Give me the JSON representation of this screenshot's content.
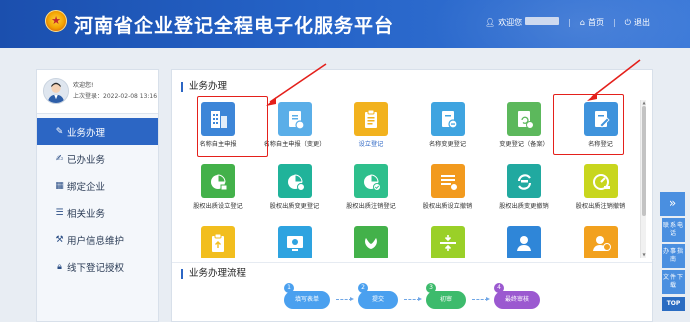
{
  "header": {
    "site_title": "河南省企业登记全程电子化服务平台",
    "welcome_prefix": "欢迎您",
    "home_label": "首页",
    "logout_label": "退出"
  },
  "sidebar": {
    "welcome": "欢迎您!",
    "last_login": "上次登录：2022-02-08 13:16",
    "items": [
      {
        "label": "业务办理",
        "icon": "pen-icon",
        "active": true
      },
      {
        "label": "已办业务",
        "icon": "doc-edit-icon"
      },
      {
        "label": "绑定企业",
        "icon": "building-icon"
      },
      {
        "label": "相关业务",
        "icon": "doc-icon"
      },
      {
        "label": "用户信息维护",
        "icon": "tools-icon"
      },
      {
        "label": "线下登记授权",
        "icon": "lock-icon"
      }
    ]
  },
  "main": {
    "section_business": "业务办理",
    "section_flow": "业务办理流程",
    "tiles": [
      {
        "label": "名称自主申报",
        "color": "#3d86d8",
        "icon": "building-grid-icon",
        "accent": false
      },
      {
        "label": "名称自主申报（变更）",
        "color": "#5aaee8",
        "icon": "doc-change-icon",
        "accent": false
      },
      {
        "label": "设立登记",
        "color": "#f2b21e",
        "icon": "clipboard-icon",
        "accent": true
      },
      {
        "label": "名称变更登记",
        "color": "#3fa4e0",
        "icon": "doc-minus-icon",
        "accent": false
      },
      {
        "label": "变更登记（备案）",
        "color": "#5cb85c",
        "icon": "doc-refresh-icon",
        "accent": false
      },
      {
        "label": "名称登记",
        "color": "#3f93dc",
        "icon": "doc-pen-icon",
        "accent": false
      },
      {
        "label": "股权出质设立登记",
        "color": "#43b14a",
        "icon": "pie-icon",
        "accent": false
      },
      {
        "label": "股权出质变更登记",
        "color": "#20b39a",
        "icon": "pie-refresh-icon",
        "accent": false
      },
      {
        "label": "股权出质注销登记",
        "color": "#2ebf8c",
        "icon": "pie-check-icon",
        "accent": false
      },
      {
        "label": "股权出质设立撤销",
        "color": "#f29a1e",
        "icon": "list-icon",
        "accent": false
      },
      {
        "label": "股权出质变更撤销",
        "color": "#21a9a0",
        "icon": "refresh-icon",
        "accent": false
      },
      {
        "label": "股权出质注销撤销",
        "color": "#c8d61e",
        "icon": "gauge-icon",
        "accent": false
      },
      {
        "label": "",
        "color": "#f2be1e",
        "icon": "clipboard-up-icon",
        "accent": false
      },
      {
        "label": "",
        "color": "#2ea3e0",
        "icon": "screen-icon",
        "accent": false
      },
      {
        "label": "",
        "color": "#43b14a",
        "icon": "lotus-icon",
        "accent": false
      },
      {
        "label": "",
        "color": "#9ad028",
        "icon": "split-icon",
        "accent": false
      },
      {
        "label": "",
        "color": "#2f86d8",
        "icon": "person-icon",
        "accent": false
      },
      {
        "label": "",
        "color": "#f2a11e",
        "icon": "person-warn-icon",
        "accent": false
      }
    ],
    "flow_steps": [
      {
        "num": "1",
        "label": "填写表单",
        "color": "#4aa0ef"
      },
      {
        "num": "2",
        "label": "提交",
        "color": "#4aa0ef"
      },
      {
        "num": "3",
        "label": "初审",
        "color": "#3dbb6c"
      },
      {
        "num": "4",
        "label": "最终审核",
        "color": "#9b59d0"
      }
    ]
  },
  "float_bar": {
    "toggle": "»",
    "items": [
      "联系电话",
      "办事指南",
      "文件下载"
    ],
    "top": "TOP"
  },
  "colors": {
    "accent": "#2c66c4",
    "highlight": "#e4201b"
  }
}
